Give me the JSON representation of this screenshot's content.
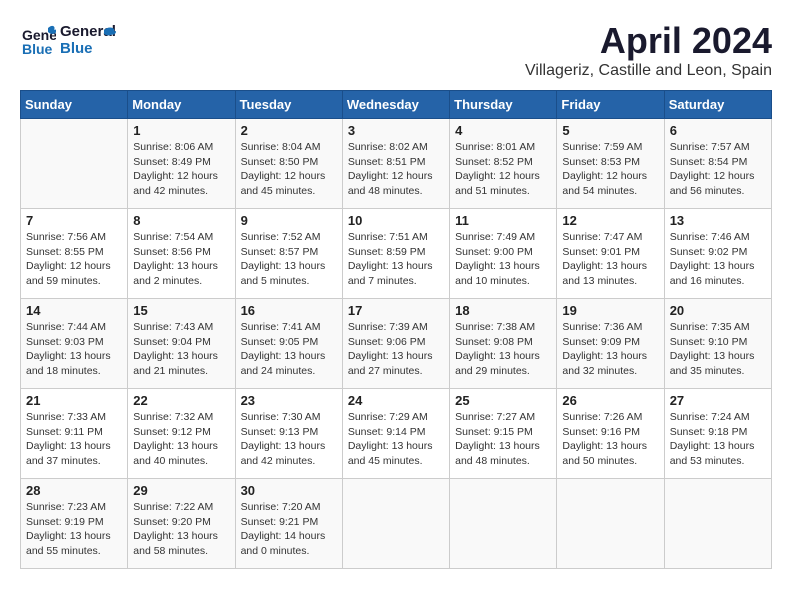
{
  "header": {
    "logo_line1": "General",
    "logo_line2": "Blue",
    "month": "April 2024",
    "location": "Villageriz, Castille and Leon, Spain"
  },
  "days_of_week": [
    "Sunday",
    "Monday",
    "Tuesday",
    "Wednesday",
    "Thursday",
    "Friday",
    "Saturday"
  ],
  "weeks": [
    [
      {
        "day": "",
        "info": ""
      },
      {
        "day": "1",
        "info": "Sunrise: 8:06 AM\nSunset: 8:49 PM\nDaylight: 12 hours\nand 42 minutes."
      },
      {
        "day": "2",
        "info": "Sunrise: 8:04 AM\nSunset: 8:50 PM\nDaylight: 12 hours\nand 45 minutes."
      },
      {
        "day": "3",
        "info": "Sunrise: 8:02 AM\nSunset: 8:51 PM\nDaylight: 12 hours\nand 48 minutes."
      },
      {
        "day": "4",
        "info": "Sunrise: 8:01 AM\nSunset: 8:52 PM\nDaylight: 12 hours\nand 51 minutes."
      },
      {
        "day": "5",
        "info": "Sunrise: 7:59 AM\nSunset: 8:53 PM\nDaylight: 12 hours\nand 54 minutes."
      },
      {
        "day": "6",
        "info": "Sunrise: 7:57 AM\nSunset: 8:54 PM\nDaylight: 12 hours\nand 56 minutes."
      }
    ],
    [
      {
        "day": "7",
        "info": "Sunrise: 7:56 AM\nSunset: 8:55 PM\nDaylight: 12 hours\nand 59 minutes."
      },
      {
        "day": "8",
        "info": "Sunrise: 7:54 AM\nSunset: 8:56 PM\nDaylight: 13 hours\nand 2 minutes."
      },
      {
        "day": "9",
        "info": "Sunrise: 7:52 AM\nSunset: 8:57 PM\nDaylight: 13 hours\nand 5 minutes."
      },
      {
        "day": "10",
        "info": "Sunrise: 7:51 AM\nSunset: 8:59 PM\nDaylight: 13 hours\nand 7 minutes."
      },
      {
        "day": "11",
        "info": "Sunrise: 7:49 AM\nSunset: 9:00 PM\nDaylight: 13 hours\nand 10 minutes."
      },
      {
        "day": "12",
        "info": "Sunrise: 7:47 AM\nSunset: 9:01 PM\nDaylight: 13 hours\nand 13 minutes."
      },
      {
        "day": "13",
        "info": "Sunrise: 7:46 AM\nSunset: 9:02 PM\nDaylight: 13 hours\nand 16 minutes."
      }
    ],
    [
      {
        "day": "14",
        "info": "Sunrise: 7:44 AM\nSunset: 9:03 PM\nDaylight: 13 hours\nand 18 minutes."
      },
      {
        "day": "15",
        "info": "Sunrise: 7:43 AM\nSunset: 9:04 PM\nDaylight: 13 hours\nand 21 minutes."
      },
      {
        "day": "16",
        "info": "Sunrise: 7:41 AM\nSunset: 9:05 PM\nDaylight: 13 hours\nand 24 minutes."
      },
      {
        "day": "17",
        "info": "Sunrise: 7:39 AM\nSunset: 9:06 PM\nDaylight: 13 hours\nand 27 minutes."
      },
      {
        "day": "18",
        "info": "Sunrise: 7:38 AM\nSunset: 9:08 PM\nDaylight: 13 hours\nand 29 minutes."
      },
      {
        "day": "19",
        "info": "Sunrise: 7:36 AM\nSunset: 9:09 PM\nDaylight: 13 hours\nand 32 minutes."
      },
      {
        "day": "20",
        "info": "Sunrise: 7:35 AM\nSunset: 9:10 PM\nDaylight: 13 hours\nand 35 minutes."
      }
    ],
    [
      {
        "day": "21",
        "info": "Sunrise: 7:33 AM\nSunset: 9:11 PM\nDaylight: 13 hours\nand 37 minutes."
      },
      {
        "day": "22",
        "info": "Sunrise: 7:32 AM\nSunset: 9:12 PM\nDaylight: 13 hours\nand 40 minutes."
      },
      {
        "day": "23",
        "info": "Sunrise: 7:30 AM\nSunset: 9:13 PM\nDaylight: 13 hours\nand 42 minutes."
      },
      {
        "day": "24",
        "info": "Sunrise: 7:29 AM\nSunset: 9:14 PM\nDaylight: 13 hours\nand 45 minutes."
      },
      {
        "day": "25",
        "info": "Sunrise: 7:27 AM\nSunset: 9:15 PM\nDaylight: 13 hours\nand 48 minutes."
      },
      {
        "day": "26",
        "info": "Sunrise: 7:26 AM\nSunset: 9:16 PM\nDaylight: 13 hours\nand 50 minutes."
      },
      {
        "day": "27",
        "info": "Sunrise: 7:24 AM\nSunset: 9:18 PM\nDaylight: 13 hours\nand 53 minutes."
      }
    ],
    [
      {
        "day": "28",
        "info": "Sunrise: 7:23 AM\nSunset: 9:19 PM\nDaylight: 13 hours\nand 55 minutes."
      },
      {
        "day": "29",
        "info": "Sunrise: 7:22 AM\nSunset: 9:20 PM\nDaylight: 13 hours\nand 58 minutes."
      },
      {
        "day": "30",
        "info": "Sunrise: 7:20 AM\nSunset: 9:21 PM\nDaylight: 14 hours\nand 0 minutes."
      },
      {
        "day": "",
        "info": ""
      },
      {
        "day": "",
        "info": ""
      },
      {
        "day": "",
        "info": ""
      },
      {
        "day": "",
        "info": ""
      }
    ]
  ]
}
